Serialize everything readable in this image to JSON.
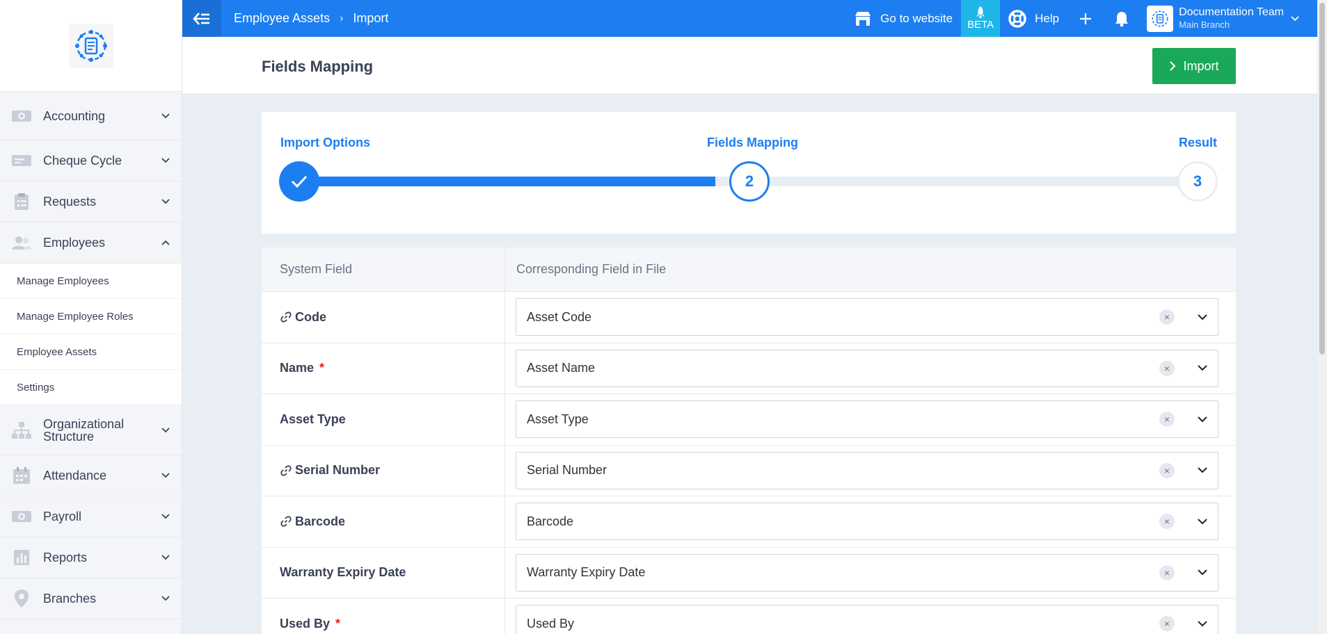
{
  "topbar": {
    "breadcrumb": [
      "Employee Assets",
      "Import"
    ],
    "go_to_website": "Go to website",
    "beta": "BETA",
    "help": "Help",
    "user_name": "Documentation Team",
    "user_branch": "Main Branch"
  },
  "sidebar": {
    "items": [
      {
        "label": "Accounting",
        "icon": "money-icon"
      },
      {
        "label": "Cheque Cycle",
        "icon": "cheque-icon"
      },
      {
        "label": "Requests",
        "icon": "clipboard-icon"
      },
      {
        "label": "Employees",
        "icon": "users-icon"
      },
      {
        "label": "Organizational Structure",
        "icon": "org-chart-icon"
      },
      {
        "label": "Attendance",
        "icon": "calendar-icon"
      },
      {
        "label": "Payroll",
        "icon": "money-icon"
      },
      {
        "label": "Reports",
        "icon": "bar-chart-icon"
      },
      {
        "label": "Branches",
        "icon": "map-pin-icon"
      }
    ],
    "employees_submenu": [
      "Manage Employees",
      "Manage Employee Roles",
      "Employee Assets",
      "Settings"
    ]
  },
  "page": {
    "title": "Fields Mapping",
    "import_button": "Import"
  },
  "stepper": {
    "steps": [
      {
        "label": "Import Options",
        "number": "1",
        "state": "done"
      },
      {
        "label": "Fields Mapping",
        "number": "2",
        "state": "active"
      },
      {
        "label": "Result",
        "number": "3",
        "state": "pending"
      }
    ]
  },
  "mapping": {
    "headers": [
      "System Field",
      "Corresponding Field in File"
    ],
    "rows": [
      {
        "field": "Code",
        "value": "Asset Code",
        "linked": true,
        "required": false
      },
      {
        "field": "Name",
        "value": "Asset Name",
        "linked": false,
        "required": true
      },
      {
        "field": "Asset Type",
        "value": "Asset Type",
        "linked": false,
        "required": false
      },
      {
        "field": "Serial Number",
        "value": "Serial Number",
        "linked": true,
        "required": false
      },
      {
        "field": "Barcode",
        "value": "Barcode",
        "linked": true,
        "required": false
      },
      {
        "field": "Warranty Expiry Date",
        "value": "Warranty Expiry Date",
        "linked": false,
        "required": false
      },
      {
        "field": "Used By",
        "value": "Used By",
        "linked": false,
        "required": true
      }
    ],
    "required_mark": "*",
    "clear_glyph": "×"
  },
  "colors": {
    "primary": "#1c7ef0",
    "success": "#1aa85b",
    "required": "#e02424"
  }
}
